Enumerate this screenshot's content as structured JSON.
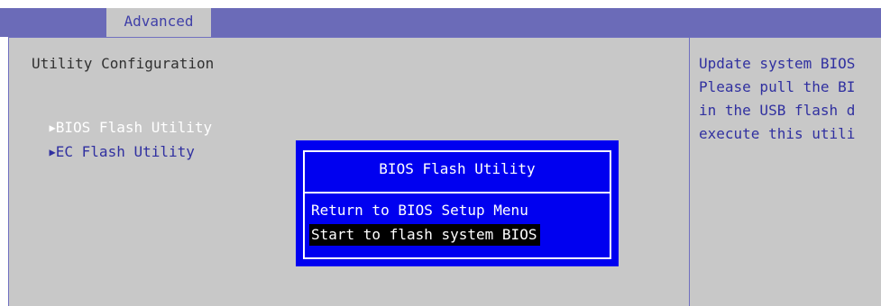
{
  "tabs": [
    {
      "label": "Advanced",
      "active": true
    }
  ],
  "main": {
    "section_title": "Utility Configuration",
    "items": [
      {
        "label": "BIOS Flash Utility",
        "selected": true
      },
      {
        "label": "EC Flash Utility",
        "selected": false
      }
    ]
  },
  "help": {
    "lines": [
      "Update system BIOS",
      "Please pull the BI",
      "in the USB flash d",
      "execute this utili"
    ]
  },
  "dialog": {
    "title": "BIOS Flash Utility",
    "options": [
      {
        "label": "Return to BIOS Setup Menu",
        "highlighted": false
      },
      {
        "label": "Start to flash system BIOS",
        "highlighted": true
      }
    ]
  },
  "colors": {
    "top_bar": "#6b6bb8",
    "panel": "#c8c8c8",
    "dialog_bg": "#0000f0",
    "text_blue": "#3030a0",
    "highlight": "#000000"
  },
  "icons": {
    "submenu": "triangle-right-icon"
  }
}
